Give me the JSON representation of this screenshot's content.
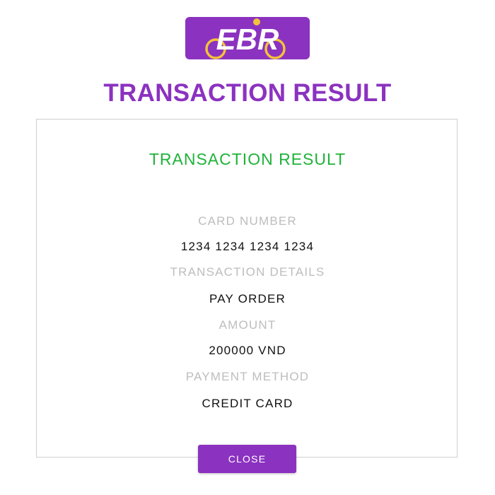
{
  "logo": {
    "text": "EBR",
    "background": "#8b32c0",
    "wheel_color": "#f2c23a",
    "icon": "bike-logo-icon"
  },
  "page_title": "TRANSACTION RESULT",
  "card": {
    "title": "TRANSACTION RESULT",
    "fields": [
      {
        "label": "CARD NUMBER",
        "value": "1234 1234 1234 1234"
      },
      {
        "label": "TRANSACTION DETAILS",
        "value": "PAY ORDER"
      },
      {
        "label": "AMOUNT",
        "value": "200000 VND"
      },
      {
        "label": "PAYMENT METHOD",
        "value": "CREDIT CARD"
      }
    ]
  },
  "close_button": {
    "label": "CLOSE"
  },
  "colors": {
    "brand": "#8b32c0",
    "success": "#1fb33a",
    "label": "#bdbdbd",
    "value": "#111111"
  }
}
